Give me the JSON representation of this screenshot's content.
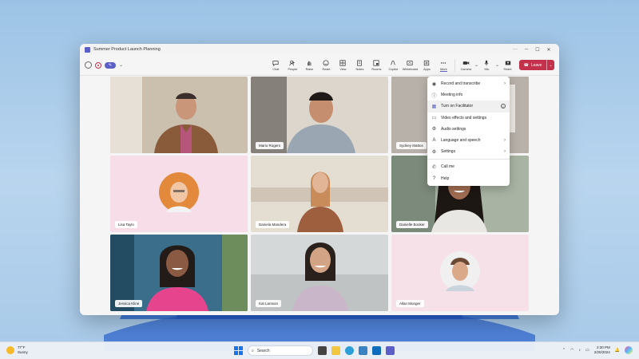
{
  "window": {
    "title": "Summer Product Launch Planning",
    "controls": [
      "more-icon",
      "minimize-icon",
      "maximize-icon",
      "close-icon"
    ]
  },
  "toolbar": {
    "buttons": [
      {
        "label": "Chat",
        "icon": "chat-icon"
      },
      {
        "label": "People",
        "icon": "people-icon"
      },
      {
        "label": "Raise",
        "icon": "raise-hand-icon"
      },
      {
        "label": "React",
        "icon": "react-icon"
      },
      {
        "label": "View",
        "icon": "view-icon"
      },
      {
        "label": "Notes",
        "icon": "notes-icon"
      },
      {
        "label": "Rooms",
        "icon": "rooms-icon"
      },
      {
        "label": "Copilot",
        "icon": "copilot-icon"
      },
      {
        "label": "Whiteboard",
        "icon": "whiteboard-icon"
      },
      {
        "label": "Apps",
        "icon": "apps-icon"
      },
      {
        "label": "More",
        "icon": "more-icon"
      }
    ],
    "camera_label": "Camera",
    "mic_label": "Mic",
    "share_label": "Share",
    "leave_label": "Leave"
  },
  "participants": [
    {
      "name": "",
      "bg": "#c9b9a4"
    },
    {
      "name": "Mario Rogers",
      "bg": "#d8d2c8"
    },
    {
      "name": "Sydney Mattos",
      "bg": "#b9b4ad",
      "speaking": true
    },
    {
      "name": "Lisa Taylo",
      "bg": "#f6dbe6",
      "avatar": true
    },
    {
      "name": "Daniela Mandera",
      "bg": "#e5ded4"
    },
    {
      "name": "Danielle Booker",
      "bg": "#a9b4a4"
    },
    {
      "name": "Jessica Kline",
      "bg": "#3d6f8a"
    },
    {
      "name": "Kat Larsson",
      "bg": "#d4d7d8"
    },
    {
      "name": "Allan Munger",
      "bg": "#f4dde6",
      "avatar": true
    }
  ],
  "more_menu": {
    "items": [
      {
        "label": "Record and transcribe",
        "icon": "record-icon",
        "submenu": true
      },
      {
        "label": "Meeting info",
        "icon": "info-icon"
      },
      {
        "label": "Turn on Facilitator",
        "icon": "facilitator-icon",
        "info": true,
        "highlight": true
      },
      {
        "label": "Video effects and settings",
        "icon": "video-effects-icon"
      },
      {
        "label": "Audio settings",
        "icon": "audio-settings-icon"
      },
      {
        "label": "Language and speech",
        "icon": "language-icon",
        "submenu": true
      },
      {
        "label": "Settings",
        "icon": "settings-icon",
        "submenu": true
      },
      {
        "divider": true
      },
      {
        "label": "Call me",
        "icon": "phone-icon"
      },
      {
        "label": "Help",
        "icon": "help-icon"
      }
    ]
  },
  "taskbar": {
    "weather_temp": "77°F",
    "weather_desc": "Sunny",
    "search_placeholder": "Search",
    "time": "2:30 PM",
    "date": "2/20/2024"
  },
  "colors": {
    "accent": "#5b5fc7",
    "leave": "#c4314b"
  }
}
